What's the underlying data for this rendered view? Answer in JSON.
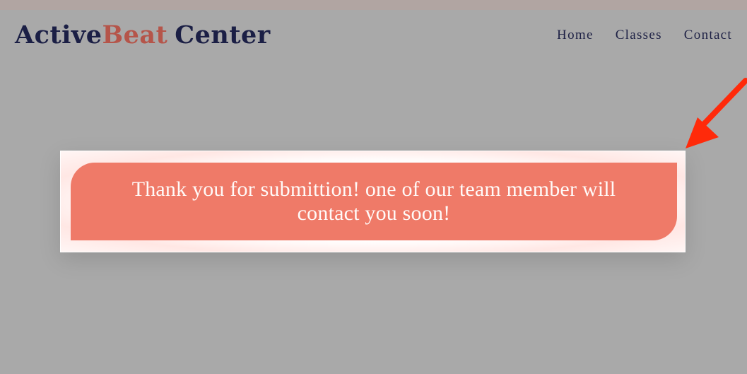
{
  "header": {
    "logo": {
      "part1": "Active",
      "part2": "Beat",
      "part3": "Center"
    },
    "nav": [
      {
        "label": "Home"
      },
      {
        "label": "Classes"
      },
      {
        "label": "Contact"
      }
    ]
  },
  "modal": {
    "message": "Thank you for submittion! one of our team member will contact you soon!"
  },
  "annotation": {
    "icon": "arrow-icon",
    "color": "#ff2a0a"
  },
  "colors": {
    "background": "#a9a9a9",
    "top_strip": "#b1a5a2",
    "logo_dark": "#1b1f45",
    "logo_accent": "#b5554a",
    "nav_text": "#1e2145",
    "message_box": "#ef7a68",
    "message_text": "#fffaf8",
    "frame": "#ffffff"
  }
}
